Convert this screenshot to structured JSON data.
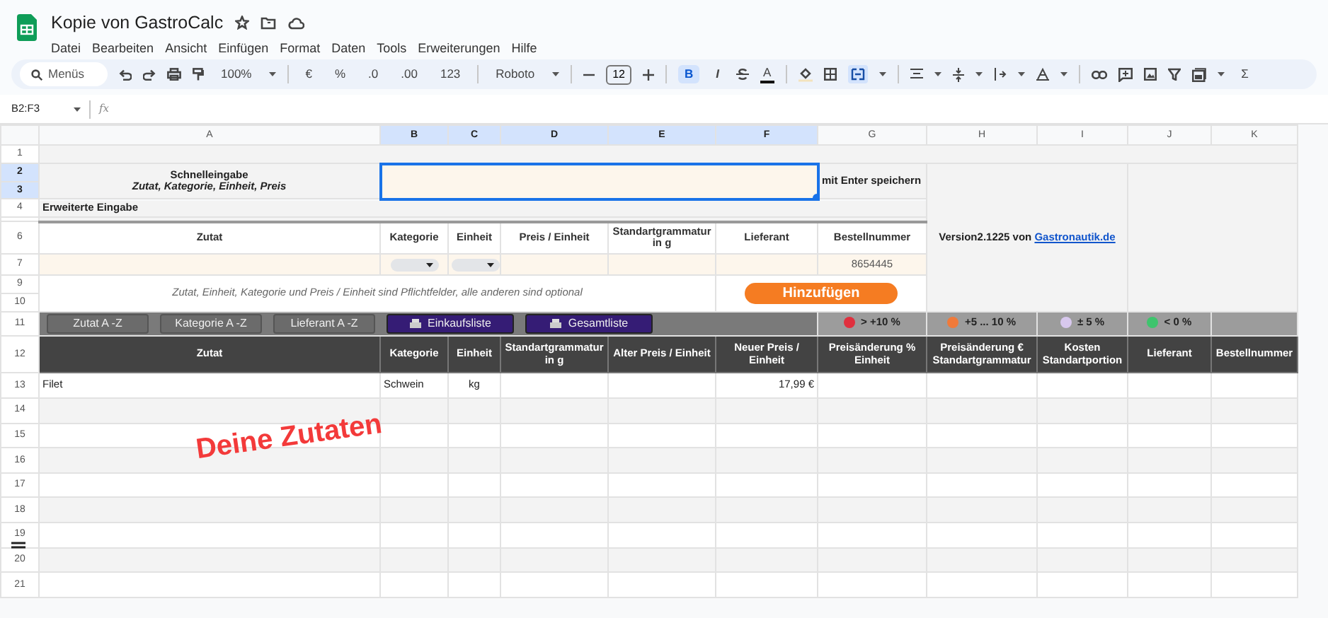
{
  "app": {
    "title": "Kopie von GastroCalc",
    "menu": [
      "Datei",
      "Bearbeiten",
      "Ansicht",
      "Einfügen",
      "Format",
      "Daten",
      "Tools",
      "Erweiterungen",
      "Hilfe"
    ]
  },
  "toolbar": {
    "search_placeholder": "Menüs",
    "zoom": "100%",
    "currency": "€",
    "percent": "%",
    "decrease_decimals": ".0",
    "increase_decimals": ".00",
    "number_format": "123",
    "font": "Roboto",
    "font_size": "12",
    "bold": {
      "label": "B",
      "selected": true
    },
    "italic": {
      "label": "I",
      "selected": false
    },
    "text_color": "A",
    "merge": {
      "selected": true
    },
    "sum": "Σ"
  },
  "formula_bar": {
    "name_box": "B2:F3",
    "fx": "fx"
  },
  "sheet": {
    "columns": [
      {
        "label": "A",
        "selected": false
      },
      {
        "label": "B",
        "selected": true
      },
      {
        "label": "C",
        "selected": true
      },
      {
        "label": "D",
        "selected": true
      },
      {
        "label": "E",
        "selected": true
      },
      {
        "label": "F",
        "selected": true
      },
      {
        "label": "G",
        "selected": false
      },
      {
        "label": "H",
        "selected": false
      },
      {
        "label": "I",
        "selected": false
      },
      {
        "label": "J",
        "selected": false
      },
      {
        "label": "K",
        "selected": false
      }
    ],
    "row_headers": [
      {
        "label": "1",
        "selected": false
      },
      {
        "label": "2",
        "selected": true
      },
      {
        "label": "3",
        "selected": true
      },
      {
        "label": "4",
        "selected": false
      },
      {
        "kind": "thin"
      },
      {
        "label": "6",
        "selected": false
      },
      {
        "label": "7",
        "selected": false
      },
      {
        "label": "9",
        "selected": false
      },
      {
        "label": "10",
        "selected": false
      },
      {
        "label": "11",
        "selected": false
      },
      {
        "label": "12",
        "selected": false
      },
      {
        "label": "13",
        "selected": false
      },
      {
        "label": "14",
        "selected": false
      },
      {
        "label": "15",
        "selected": false
      },
      {
        "label": "16",
        "selected": false
      },
      {
        "label": "17",
        "selected": false
      },
      {
        "label": "18",
        "selected": false
      },
      {
        "label": "19",
        "selected": false
      },
      {
        "label": "20",
        "selected": false
      },
      {
        "label": "21",
        "selected": false
      }
    ],
    "quick_entry": {
      "title": "Schnelleingabe",
      "subtitle": "Zutat, Kategorie, Einheit, Preis",
      "hint": "mit Enter speichern"
    },
    "extended_entry": {
      "title": "Erweiterte Eingabe",
      "headers": [
        "Zutat",
        "Kategorie",
        "Einheit",
        "Preis / Einheit",
        "Standartgrammatur in g",
        "Lieferant",
        "Bestellnummer"
      ],
      "order_number": "8654445",
      "note": "Zutat, Einheit, Kategorie und Preis / Einheit sind Pflichtfelder, alle anderen sind optional",
      "add_button": "Hinzufügen"
    },
    "version": {
      "text": "Version2.1225 von",
      "link": "Gastronautik.de"
    },
    "sort_buttons": [
      "Zutat A -Z",
      "Kategorie A -Z",
      "Lieferant A -Z"
    ],
    "list_buttons": [
      "Einkaufsliste",
      "Gesamtliste"
    ],
    "legend": [
      {
        "label": "> +10 %",
        "color": "#e0303e"
      },
      {
        "label": "+5 ... 10 %",
        "color": "#f07a3a"
      },
      {
        "label": "± 5 %",
        "color": "#d8c8ee"
      },
      {
        "label": "< 0 %",
        "color": "#3ec46d"
      }
    ],
    "table": {
      "headers": [
        "Zutat",
        "Kategorie",
        "Einheit",
        "Standartgrammatur in g",
        "Alter Preis / Einheit",
        "Neuer Preis / Einheit",
        "Preisänderung % Einheit",
        "Preisänderung € Standartgrammatur",
        "Kosten Standartportion",
        "Lieferant",
        "Bestellnummer"
      ],
      "rows": [
        {
          "zutat": "Filet",
          "kategorie": "Schwein",
          "einheit": "kg",
          "neuer_preis": "17,99 €"
        }
      ]
    },
    "annotation": "Deine Zutaten"
  }
}
